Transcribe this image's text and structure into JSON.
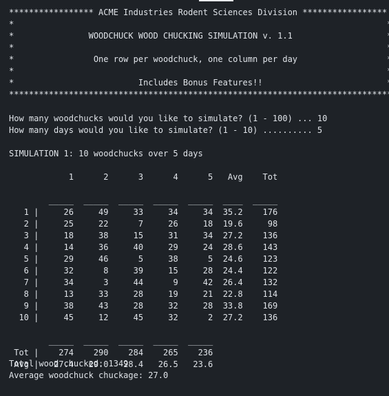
{
  "terminal": {
    "banner": [
      "***************** ACME Industries Rodent Sciences Division *****************",
      "*                                                                           *",
      "*               WOODCHUCK WOOD CHUCKING SIMULATION v. 1.1                   *",
      "*                                                                           *",
      "*                One row per woodchuck, one column per day                  *",
      "*                                                                           *",
      "*                         Includes Bonus Features!!                         *",
      "*****************************************************************************"
    ],
    "prompts": [
      "How many woodchucks would you like to simulate? (1 - 100) ... 10",
      "How many days would you like to simulate? (1 - 10) .......... 5"
    ],
    "sim_title": "SIMULATION 1: 10 woodchucks over 5 days",
    "table": {
      "columns": [
        "1",
        "2",
        "3",
        "4",
        "5",
        "Avg",
        "Tot"
      ],
      "rows": [
        {
          "id": "1",
          "values": [
            "26",
            "49",
            "33",
            "34",
            "34",
            "35.2",
            "176"
          ]
        },
        {
          "id": "2",
          "values": [
            "25",
            "22",
            "7",
            "26",
            "18",
            "19.6",
            "98"
          ]
        },
        {
          "id": "3",
          "values": [
            "18",
            "38",
            "15",
            "31",
            "34",
            "27.2",
            "136"
          ]
        },
        {
          "id": "4",
          "values": [
            "14",
            "36",
            "40",
            "29",
            "24",
            "28.6",
            "143"
          ]
        },
        {
          "id": "5",
          "values": [
            "29",
            "46",
            "5",
            "38",
            "5",
            "24.6",
            "123"
          ]
        },
        {
          "id": "6",
          "values": [
            "32",
            "8",
            "39",
            "15",
            "28",
            "24.4",
            "122"
          ]
        },
        {
          "id": "7",
          "values": [
            "34",
            "3",
            "44",
            "9",
            "42",
            "26.4",
            "132"
          ]
        },
        {
          "id": "8",
          "values": [
            "13",
            "33",
            "28",
            "19",
            "21",
            "22.8",
            "114"
          ]
        },
        {
          "id": "9",
          "values": [
            "38",
            "43",
            "28",
            "32",
            "28",
            "33.8",
            "169"
          ]
        },
        {
          "id": "10",
          "values": [
            "45",
            "12",
            "45",
            "32",
            "2",
            "27.2",
            "136"
          ]
        }
      ],
      "footer": [
        {
          "label": "Tot",
          "values": [
            "274",
            "290",
            "284",
            "265",
            "236"
          ]
        },
        {
          "label": "Avg",
          "values": [
            "27.4",
            "29.0",
            "28.4",
            "26.5",
            "23.6"
          ]
        }
      ]
    },
    "total_wood": "Total wood chucked: 1349",
    "average_chuckage": "Average woodchuck chuckage: 27.0"
  }
}
